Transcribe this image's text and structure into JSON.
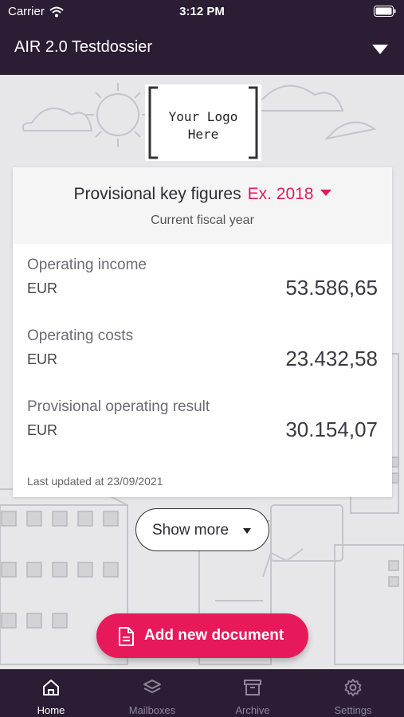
{
  "status_bar": {
    "carrier": "Carrier",
    "time": "3:12 PM"
  },
  "header": {
    "title": "AIR 2.0 Testdossier"
  },
  "logo": {
    "text": "Your Logo\nHere"
  },
  "key_figures": {
    "title": "Provisional key figures",
    "year_label": "Ex. 2018",
    "subtitle": "Current fiscal year",
    "items": [
      {
        "label": "Operating income",
        "currency": "EUR",
        "value": "53.586,65"
      },
      {
        "label": "Operating costs",
        "currency": "EUR",
        "value": "23.432,58"
      },
      {
        "label": "Provisional operating result",
        "currency": "EUR",
        "value": "30.154,07"
      }
    ],
    "last_updated": "Last updated at 23/09/2021"
  },
  "show_more": {
    "label": "Show more"
  },
  "add_document": {
    "label": "Add new document",
    "icon": "document-icon"
  },
  "tabbar": {
    "items": [
      {
        "label": "Home",
        "icon": "home-icon",
        "active": true
      },
      {
        "label": "Mailboxes",
        "icon": "layers-icon",
        "active": false
      },
      {
        "label": "Archive",
        "icon": "archive-icon",
        "active": false
      },
      {
        "label": "Settings",
        "icon": "gear-icon",
        "active": false
      }
    ]
  },
  "colors": {
    "brand_dark": "#2a1d34",
    "accent": "#e8195b",
    "background": "#e7e6e9"
  }
}
